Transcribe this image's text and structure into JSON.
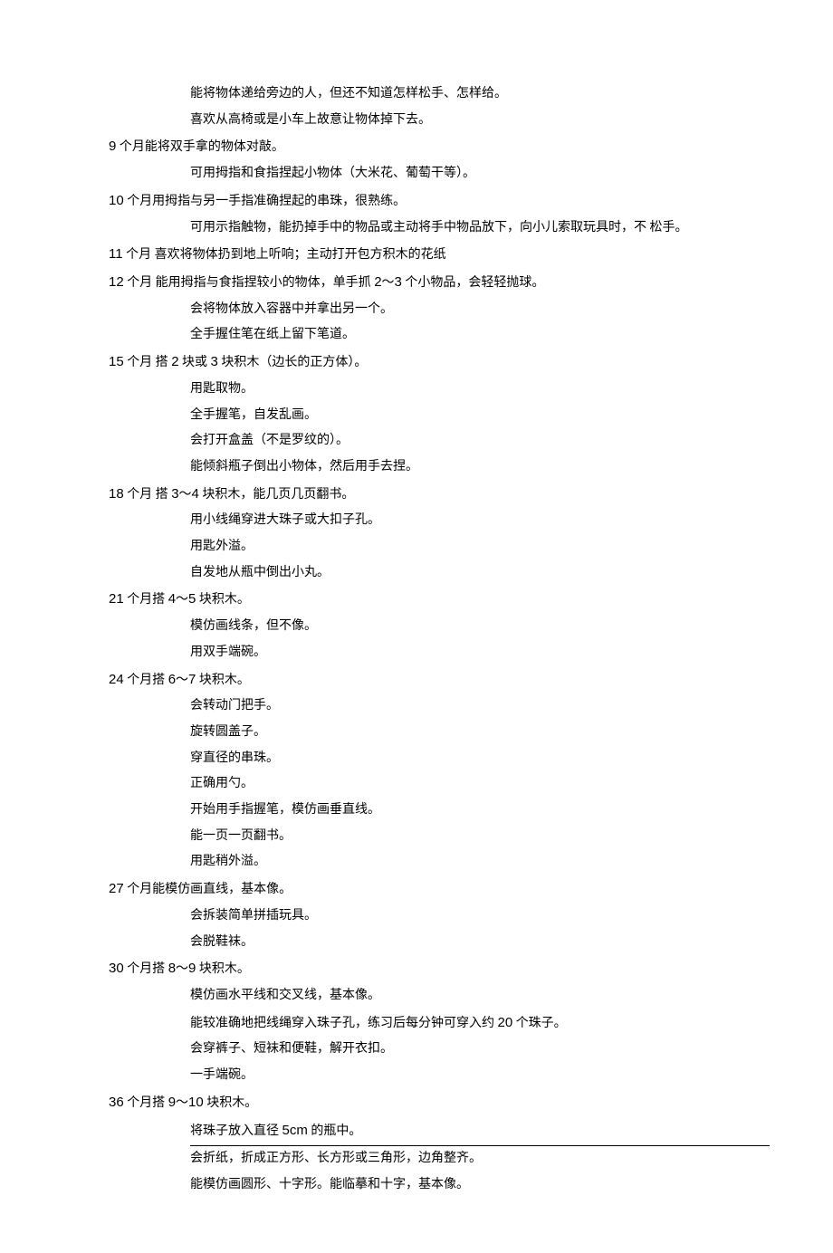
{
  "lines": [
    {
      "indent": 1,
      "segments": [
        {
          "t": "能将物体递给旁边的人，但还不知道怎样松手、怎样给。"
        }
      ]
    },
    {
      "indent": 1,
      "segments": [
        {
          "t": "喜欢从高椅或是小车上故意让物体掉下去。"
        }
      ]
    },
    {
      "indent": 0,
      "segments": [
        {
          "t": "9",
          "num": true
        },
        {
          "t": " 个月能将双手拿的物体对敲。"
        }
      ]
    },
    {
      "indent": 1,
      "segments": [
        {
          "t": "可用拇指和食指捏起小物体（大米花、葡萄干等）。"
        }
      ]
    },
    {
      "indent": 0,
      "segments": [
        {
          "t": "10",
          "num": true
        },
        {
          "t": " 个月用拇指与另一手指准确捏起的串珠，很熟练。"
        }
      ]
    },
    {
      "indent": 1,
      "segments": [
        {
          "t": "可用示指触物，能扔掉手中的物品或主动将手中物品放下，向小儿索取玩具时，不 松手。"
        }
      ]
    },
    {
      "indent": 0,
      "segments": [
        {
          "t": "11",
          "num": true
        },
        {
          "t": " 个月  喜欢将物体扔到地上听响；主动打开包方积木的花纸"
        }
      ]
    },
    {
      "indent": 0,
      "segments": [
        {
          "t": "12",
          "num": true
        },
        {
          "t": " 个月  能用拇指与食指捏较小的物体，单手抓 "
        },
        {
          "t": "2",
          "num": true
        },
        {
          "t": "〜"
        },
        {
          "t": "3",
          "num": true
        },
        {
          "t": " 个小物品，会轻轻抛球。"
        }
      ]
    },
    {
      "indent": 1,
      "segments": [
        {
          "t": "会将物体放入容器中并拿出另一个。"
        }
      ]
    },
    {
      "indent": 1,
      "segments": [
        {
          "t": "全手握住笔在纸上留下笔道。"
        }
      ]
    },
    {
      "indent": 0,
      "segments": [
        {
          "t": "15",
          "num": true
        },
        {
          "t": " 个月  搭 "
        },
        {
          "t": "2",
          "num": true
        },
        {
          "t": " 块或 "
        },
        {
          "t": "3",
          "num": true
        },
        {
          "t": " 块积木（边长的正方体）。"
        }
      ]
    },
    {
      "indent": 1,
      "segments": [
        {
          "t": "用匙取物。"
        }
      ]
    },
    {
      "indent": 1,
      "segments": [
        {
          "t": "全手握笔，自发乱画。"
        }
      ]
    },
    {
      "indent": 1,
      "segments": [
        {
          "t": "会打开盒盖（不是罗纹的）。"
        }
      ]
    },
    {
      "indent": 1,
      "segments": [
        {
          "t": "能倾斜瓶子倒出小物体，然后用手去捏。"
        }
      ]
    },
    {
      "indent": 0,
      "segments": [
        {
          "t": "18",
          "num": true
        },
        {
          "t": " 个月  搭 "
        },
        {
          "t": "3",
          "num": true
        },
        {
          "t": "〜"
        },
        {
          "t": "4",
          "num": true
        },
        {
          "t": " 块积木，能几页几页翻书。"
        }
      ]
    },
    {
      "indent": 1,
      "segments": [
        {
          "t": "用小线绳穿进大珠子或大扣子孔。"
        }
      ]
    },
    {
      "indent": 1,
      "segments": [
        {
          "t": "用匙外溢。"
        }
      ]
    },
    {
      "indent": 1,
      "segments": [
        {
          "t": "自发地从瓶中倒出小丸。"
        }
      ]
    },
    {
      "indent": 0,
      "segments": [
        {
          "t": "21",
          "num": true
        },
        {
          "t": " 个月搭 "
        },
        {
          "t": "4",
          "num": true
        },
        {
          "t": "〜"
        },
        {
          "t": "5",
          "num": true
        },
        {
          "t": " 块积木。"
        }
      ]
    },
    {
      "indent": 1,
      "segments": [
        {
          "t": "模仿画线条，但不像。"
        }
      ]
    },
    {
      "indent": 1,
      "segments": [
        {
          "t": "用双手端碗。"
        }
      ]
    },
    {
      "indent": 0,
      "segments": [
        {
          "t": "24",
          "num": true
        },
        {
          "t": " 个月搭 "
        },
        {
          "t": "6",
          "num": true
        },
        {
          "t": "〜"
        },
        {
          "t": "7",
          "num": true
        },
        {
          "t": " 块积木。"
        }
      ]
    },
    {
      "indent": 1,
      "segments": [
        {
          "t": "会转动门把手。"
        }
      ]
    },
    {
      "indent": 1,
      "segments": [
        {
          "t": "旋转圆盖子。"
        }
      ]
    },
    {
      "indent": 1,
      "segments": [
        {
          "t": "穿直径的串珠。"
        }
      ]
    },
    {
      "indent": 1,
      "segments": [
        {
          "t": "正确用勺。"
        }
      ]
    },
    {
      "indent": 1,
      "segments": [
        {
          "t": "开始用手指握笔，模仿画垂直线。"
        }
      ]
    },
    {
      "indent": 1,
      "segments": [
        {
          "t": "能一页一页翻书。"
        }
      ]
    },
    {
      "indent": 1,
      "segments": [
        {
          "t": "用匙稍外溢。"
        }
      ]
    },
    {
      "indent": 0,
      "segments": [
        {
          "t": "27",
          "num": true
        },
        {
          "t": " 个月能模仿画直线，基本像。"
        }
      ]
    },
    {
      "indent": 1,
      "segments": [
        {
          "t": "会拆装简单拼插玩具。"
        }
      ]
    },
    {
      "indent": 1,
      "segments": [
        {
          "t": "会脱鞋袜。"
        }
      ]
    },
    {
      "indent": 0,
      "segments": [
        {
          "t": "30",
          "num": true
        },
        {
          "t": " 个月搭 "
        },
        {
          "t": "8",
          "num": true
        },
        {
          "t": "〜"
        },
        {
          "t": "9",
          "num": true
        },
        {
          "t": " 块积木。"
        }
      ]
    },
    {
      "indent": 1,
      "segments": [
        {
          "t": "模仿画水平线和交叉线，基本像。"
        }
      ]
    },
    {
      "indent": 1,
      "segments": [
        {
          "t": "能较准确地把线绳穿入珠子孔，练习后每分钟可穿入约 "
        },
        {
          "t": "20",
          "num": true
        },
        {
          "t": " 个珠子。"
        }
      ]
    },
    {
      "indent": 1,
      "segments": [
        {
          "t": "会穿裤子、短袜和便鞋，解开衣扣。"
        }
      ]
    },
    {
      "indent": 1,
      "segments": [
        {
          "t": "一手端碗。"
        }
      ]
    },
    {
      "indent": 0,
      "segments": [
        {
          "t": "36",
          "num": true
        },
        {
          "t": " 个月搭 "
        },
        {
          "t": "9",
          "num": true
        },
        {
          "t": "〜"
        },
        {
          "t": "10",
          "num": true
        },
        {
          "t": " 块积木。"
        }
      ]
    },
    {
      "indent": 1,
      "underlined": true,
      "segments": [
        {
          "t": "将珠子放入直径  "
        },
        {
          "t": "5cm",
          "num": true
        },
        {
          "t": " 的瓶中。"
        }
      ]
    },
    {
      "indent": 1,
      "segments": [
        {
          "t": "会折纸，折成正方形、长方形或三角形，边角整齐。"
        }
      ]
    },
    {
      "indent": 1,
      "segments": [
        {
          "t": "能模仿画圆形、十字形。能临摹和十字，基本像。"
        }
      ]
    }
  ]
}
